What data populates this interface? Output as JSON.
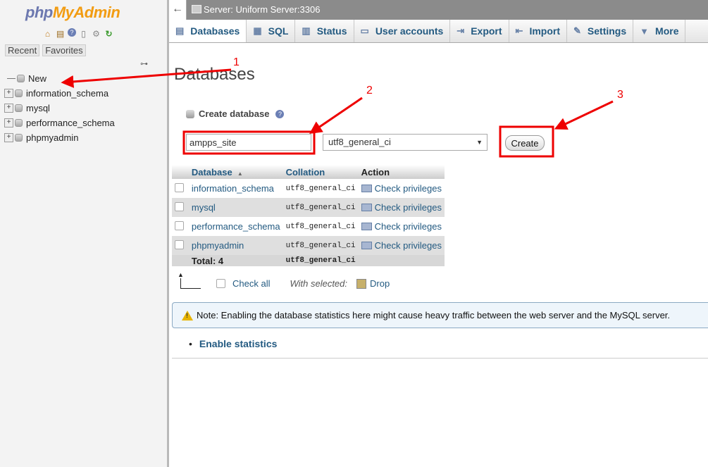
{
  "sidebar": {
    "logo": {
      "php": "php",
      "admin": "MyAdmin"
    },
    "icons": [
      "home-icon",
      "database-icon",
      "help-icon",
      "docs-icon",
      "settings-icon",
      "reload-icon"
    ],
    "tabs": {
      "recent": "Recent",
      "favorites": "Favorites"
    },
    "tree": {
      "new_label": "New",
      "databases": [
        "information_schema",
        "mysql",
        "performance_schema",
        "phpmyadmin"
      ]
    }
  },
  "topbar": {
    "back": "←",
    "server": "Server: Uniform Server:3306"
  },
  "tabs": [
    {
      "label": "Databases",
      "icon": "database-icon",
      "active": true
    },
    {
      "label": "SQL",
      "icon": "sql-icon"
    },
    {
      "label": "Status",
      "icon": "status-icon"
    },
    {
      "label": "User accounts",
      "icon": "user-accounts-icon"
    },
    {
      "label": "Export",
      "icon": "export-icon"
    },
    {
      "label": "Import",
      "icon": "import-icon"
    },
    {
      "label": "Settings",
      "icon": "settings-icon"
    },
    {
      "label": "More",
      "icon": "chevron-down-icon"
    }
  ],
  "main": {
    "title": "Databases",
    "create": {
      "label": "Create database",
      "name_value": "ampps_site",
      "collation": "utf8_general_ci",
      "button": "Create"
    },
    "table": {
      "headers": {
        "database": "Database",
        "sort": "▲",
        "collation": "Collation",
        "action": "Action"
      },
      "rows": [
        {
          "database": "information_schema",
          "collation": "utf8_general_ci",
          "action": "Check privileges"
        },
        {
          "database": "mysql",
          "collation": "utf8_general_ci",
          "action": "Check privileges"
        },
        {
          "database": "performance_schema",
          "collation": "utf8_general_ci",
          "action": "Check privileges"
        },
        {
          "database": "phpmyadmin",
          "collation": "utf8_general_ci",
          "action": "Check privileges"
        }
      ],
      "total": {
        "label": "Total: 4",
        "collation": "utf8_general_ci"
      }
    },
    "check_all": "Check all",
    "with_selected": "With selected:",
    "drop": "Drop",
    "notice": "Note: Enabling the database statistics here might cause heavy traffic between the web server and the MySQL server.",
    "enable_stats": "Enable statistics"
  },
  "annotations": {
    "one": "1",
    "two": "2",
    "three": "3",
    "color": "#e00000"
  },
  "colors": {
    "link": "#235a81",
    "logo_php": "#6c78af",
    "logo_admin": "#f29c12"
  }
}
